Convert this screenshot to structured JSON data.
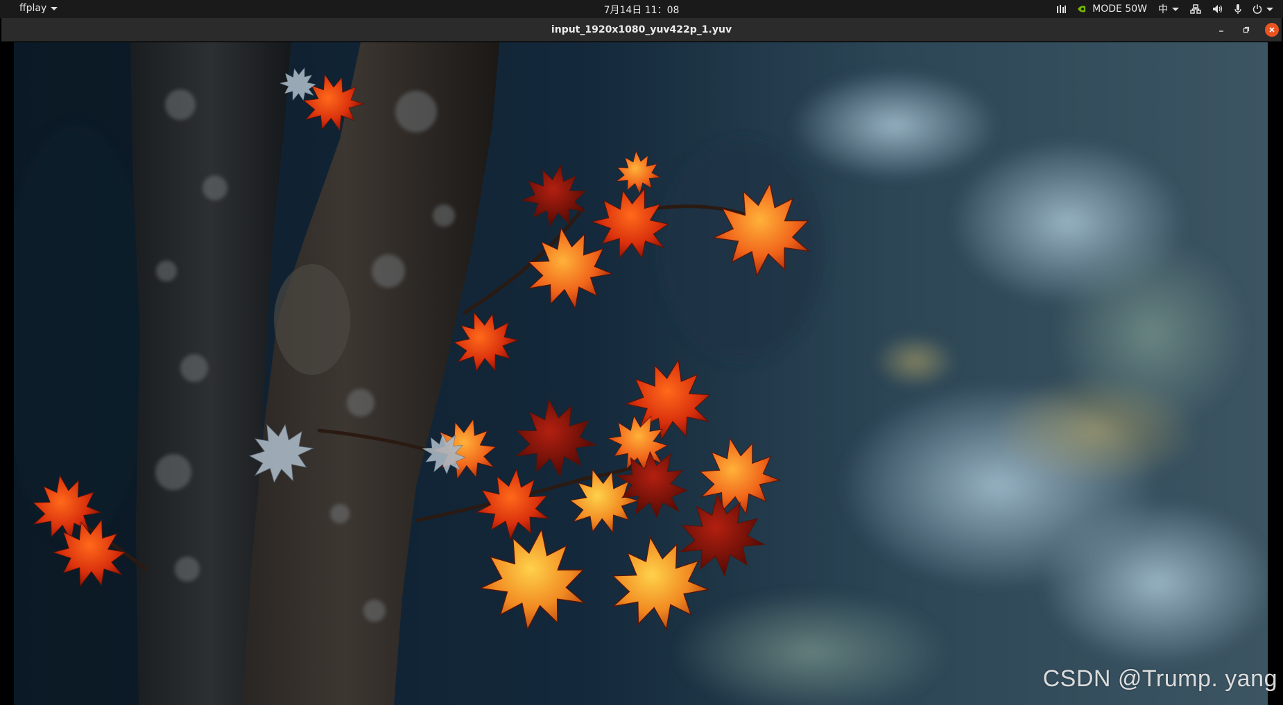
{
  "topbar": {
    "app_menu": "ffplay",
    "clock": "7月14日  11：08",
    "gpu_mode": "MODE 50W",
    "input_method": "中"
  },
  "window": {
    "title": "input_1920x1080_yuv422p_1.yuv"
  },
  "video": {
    "scene": "red autumn maple leaves beside a tree trunk in a blue-toned forest",
    "watermark": "CSDN @Trump. yang"
  },
  "colors": {
    "close_button": "#e95420",
    "topbar_bg": "#1a1a1a",
    "titlebar_bg": "#2b2b2b"
  }
}
